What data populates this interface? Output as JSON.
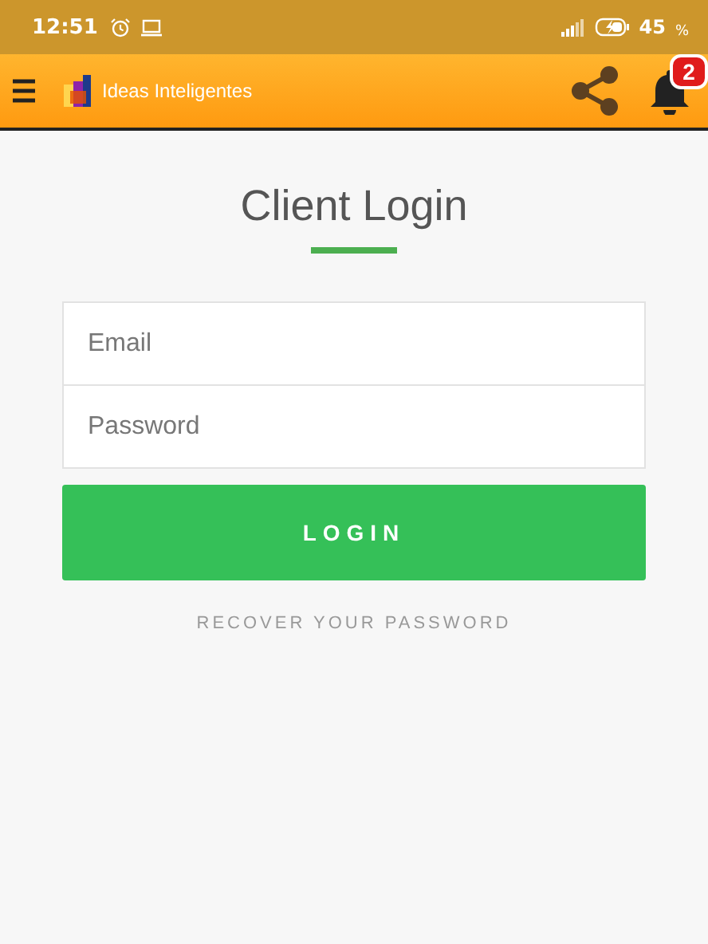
{
  "status_bar": {
    "time": "12:51",
    "battery": "45",
    "percent_sign": "%"
  },
  "app_bar": {
    "title": "Ideas Inteligentes",
    "notification_count": "2"
  },
  "login": {
    "title": "Client Login",
    "fields": [
      {
        "placeholder": "Email"
      },
      {
        "placeholder": "Password"
      }
    ],
    "button": "LOGIN",
    "recover_link": "RECOVER YOUR PASSWORD"
  }
}
